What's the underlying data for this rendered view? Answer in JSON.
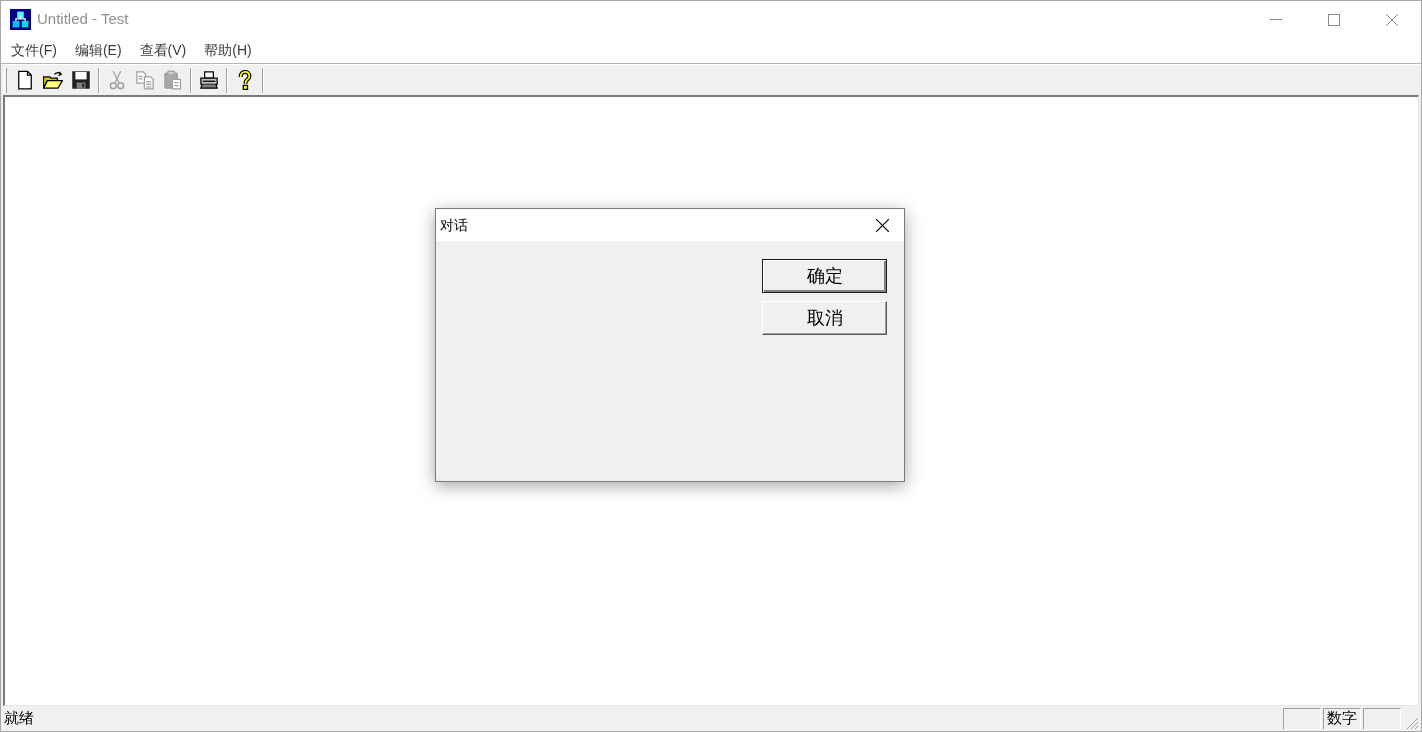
{
  "window": {
    "title": "Untitled - Test",
    "active": false
  },
  "menu": [
    {
      "label": "文件(F)"
    },
    {
      "label": "编辑(E)"
    },
    {
      "label": "查看(V)"
    },
    {
      "label": "帮助(H)"
    }
  ],
  "toolbar": {
    "groups": [
      {
        "buttons": [
          {
            "disabled": false
          },
          {
            "disabled": false
          },
          {
            "disabled": false
          }
        ]
      },
      {
        "buttons": [
          {
            "disabled": true
          },
          {
            "disabled": true
          },
          {
            "disabled": true
          }
        ]
      },
      {
        "buttons": [
          {
            "disabled": false
          }
        ]
      },
      {
        "buttons": [
          {
            "disabled": false
          }
        ]
      }
    ]
  },
  "dialog": {
    "title": "对话",
    "buttons": [
      {
        "label": "确定",
        "default": true
      },
      {
        "label": "取消",
        "default": false
      }
    ]
  },
  "status_bar": {
    "message": "就绪",
    "indicators": [
      {
        "kind": "empty"
      },
      {
        "kind": "label",
        "label": "数字"
      },
      {
        "kind": "empty"
      }
    ]
  }
}
